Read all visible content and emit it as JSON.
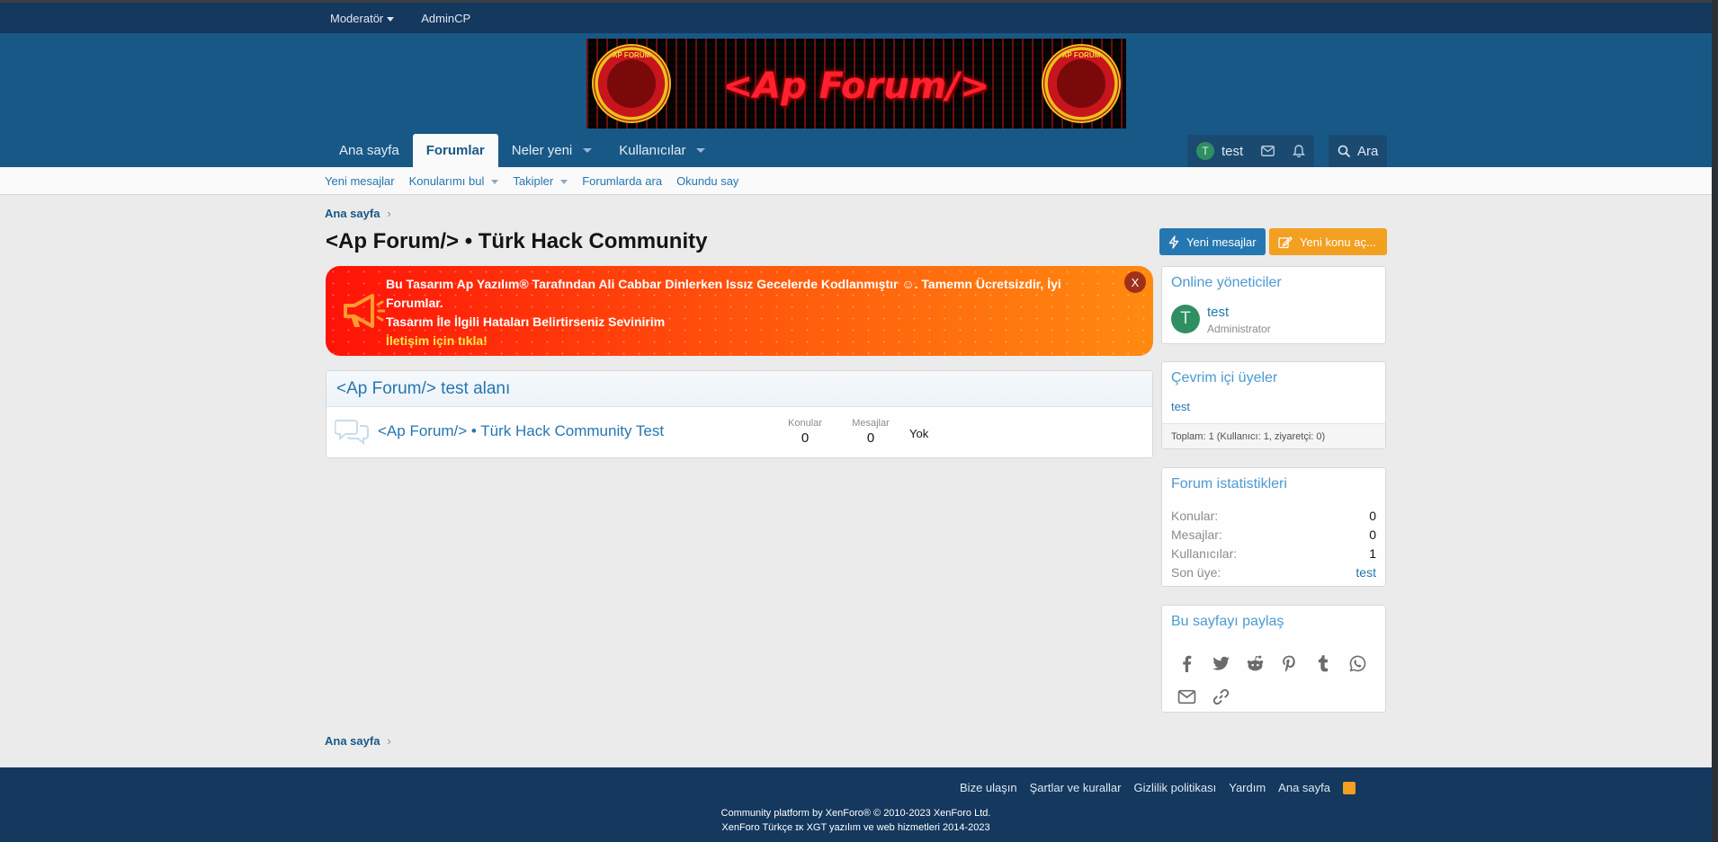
{
  "staff_bar": {
    "moderator": "Moderatör",
    "admincp": "AdminCP"
  },
  "banner": {
    "logo_text": "<Ap Forum/>",
    "emblem_text": "AP FORUM"
  },
  "nav": {
    "tabs": [
      {
        "label": "Ana sayfa"
      },
      {
        "label": "Forumlar"
      },
      {
        "label": "Neler yeni"
      },
      {
        "label": "Kullanıcılar"
      }
    ],
    "user_avatar": "T",
    "user_name": "test",
    "search_label": "Ara"
  },
  "subnav": {
    "items": [
      "Yeni mesajlar",
      "Konularımı bul",
      "Takipler",
      "Forumlarda ara",
      "Okundu say"
    ]
  },
  "breadcrumb": {
    "home": "Ana sayfa"
  },
  "page": {
    "title": "<Ap Forum/> • Türk Hack Community"
  },
  "buttons": {
    "new_posts": "Yeni mesajlar",
    "new_thread": "Yeni konu aç..."
  },
  "notice": {
    "line1": "Bu Tasarım Ap Yazılım® Tarafından Ali Cabbar Dinlerken Issız Gecelerde Kodlanmıştır ☺. Tamemn Ücretsizdir, İyi Forumlar.",
    "line2": "Tasarım İle İlgili Hataları Belirtirseniz Sevinirim",
    "line3": "İletişim için tıkla!",
    "close": "X"
  },
  "forum_block": {
    "category": "<Ap Forum/> test alanı",
    "forum_title": "<Ap Forum/> • Türk Hack Community Test",
    "threads_label": "Konular",
    "threads_value": "0",
    "messages_label": "Mesajlar",
    "messages_value": "0",
    "latest": "Yok"
  },
  "sidebar": {
    "online_staff": {
      "title": "Online yöneticiler",
      "avatar": "T",
      "name": "test",
      "role": "Administrator"
    },
    "online_members": {
      "title": "Çevrim içi üyeler",
      "member": "test",
      "total": "Toplam: 1 (Kullanıcı: 1, ziyaretçi: 0)"
    },
    "stats": {
      "title": "Forum istatistikleri",
      "rows": [
        {
          "label": "Konular:",
          "value": "0"
        },
        {
          "label": "Mesajlar:",
          "value": "0"
        },
        {
          "label": "Kullanıcılar:",
          "value": "1"
        },
        {
          "label": "Son üye:",
          "value": "test"
        }
      ]
    },
    "share": {
      "title": "Bu sayfayı paylaş"
    }
  },
  "footer": {
    "links": [
      "Bize ulaşın",
      "Şartlar ve kurallar",
      "Gizlilik politikası",
      "Yardım",
      "Ana sayfa"
    ],
    "copyright": "Community platform by XenForo® © 2010-2023 XenForo Ltd.",
    "translation": "XenForo Türkçe ɪᴋ XGT yazılım ve web hizmetleri 2014-2023"
  },
  "colors": {
    "header": "#185886",
    "staff_bar": "#14385e",
    "link": "#2577b1",
    "orange": "#f39f1f"
  }
}
